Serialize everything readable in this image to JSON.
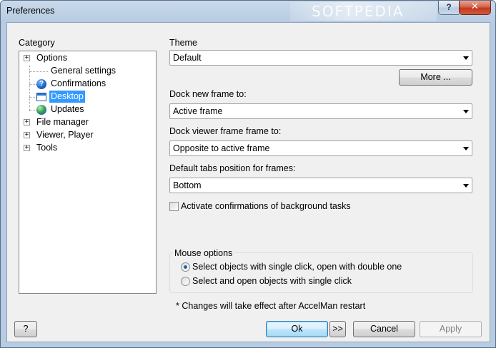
{
  "window": {
    "title": "Preferences",
    "watermark": "SOFTPEDIA",
    "help_glyph": "?",
    "close_glyph": "✕"
  },
  "category": {
    "label": "Category",
    "items": [
      {
        "label": "Options",
        "expander": "+"
      },
      {
        "label": "General settings"
      },
      {
        "label": "Confirmations"
      },
      {
        "label": "Desktop"
      },
      {
        "label": "Updates"
      },
      {
        "label": "File manager",
        "expander": "+"
      },
      {
        "label": "Viewer, Player",
        "expander": "+"
      },
      {
        "label": "Tools",
        "expander": "+"
      }
    ]
  },
  "settings": {
    "theme_label": "Theme",
    "theme_value": "Default",
    "more_button": "More ...",
    "dock_new_label": "Dock new frame to:",
    "dock_new_value": "Active frame",
    "dock_viewer_label": "Dock viewer frame frame to:",
    "dock_viewer_value": "Opposite to active frame",
    "tabs_position_label": "Default tabs position for frames:",
    "tabs_position_value": "Bottom",
    "activate_confirmations_label": "Activate confirmations of background tasks",
    "activate_confirmations_checked": false
  },
  "mouse_options": {
    "title": "Mouse options",
    "option1": "Select objects with single click, open with double one",
    "option2": "Select and open objects with single click",
    "selected": 1
  },
  "note": "* Changes will take effect after AccelMan restart",
  "footer": {
    "help_button": "?",
    "ok_button": "Ok",
    "next_button": ">>",
    "cancel_button": "Cancel",
    "apply_button": "Apply"
  }
}
